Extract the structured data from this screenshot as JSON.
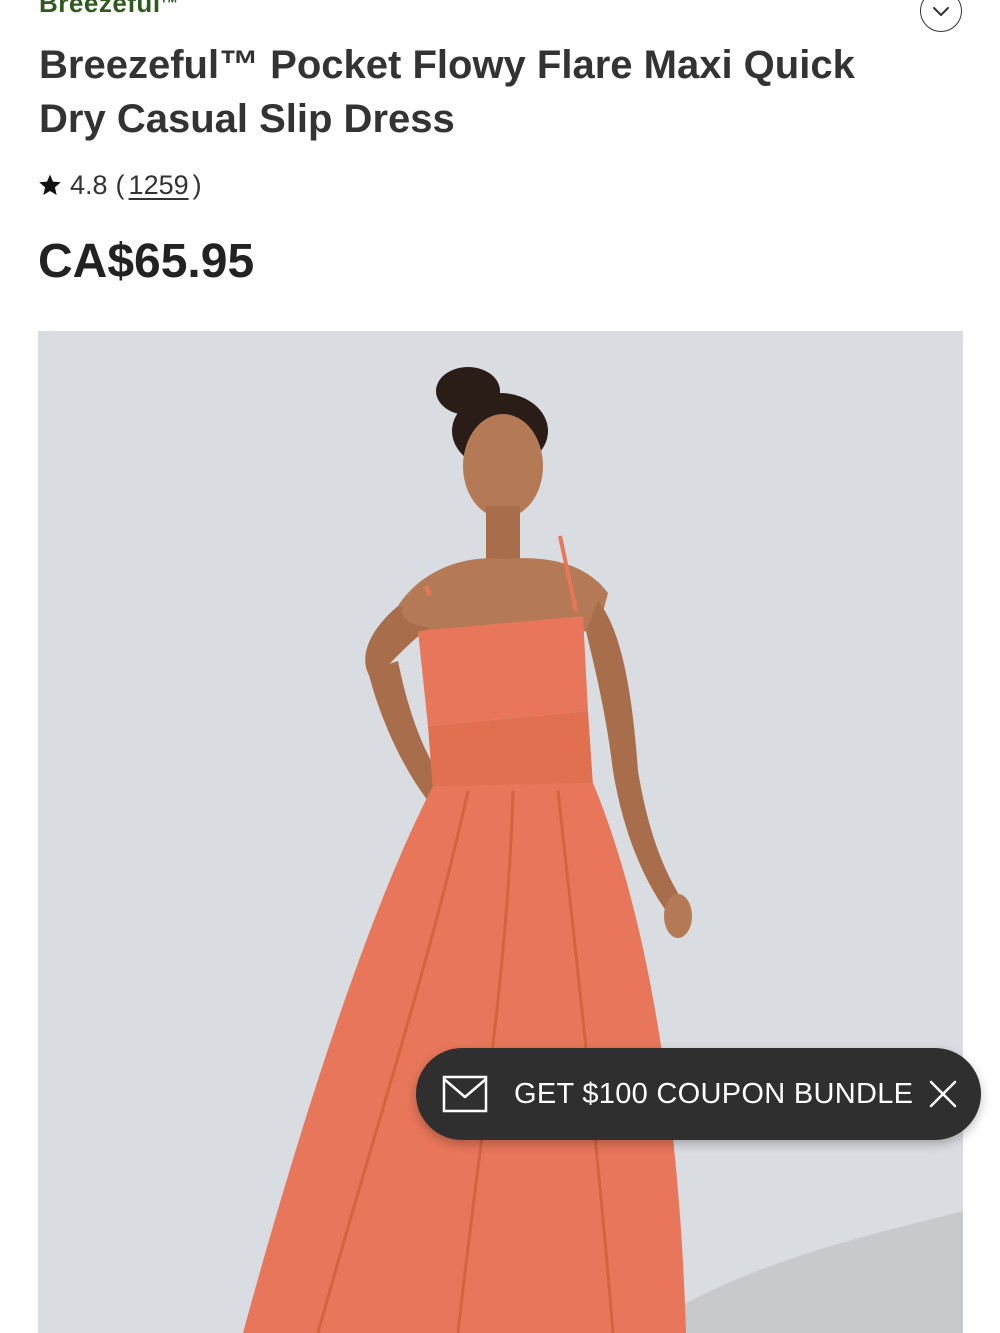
{
  "header": {
    "brand_link": "Breezeful",
    "brand_mark": "TM"
  },
  "product": {
    "title": "Breezeful™ Pocket Flowy Flare Maxi Quick Dry Casual Slip Dress",
    "rating": "4.8",
    "open_paren": "(",
    "review_count": "1259",
    "close_paren": ")",
    "price": "CA$65.95",
    "dress_color": "#e8765a",
    "image_background": "#d9dce1"
  },
  "coupon": {
    "label": "GET $100 COUPON BUNDLE"
  },
  "icons": {
    "expand": "chevron-down-icon",
    "rating": "star-icon",
    "coupon": "mail-icon",
    "dismiss": "close-icon"
  }
}
